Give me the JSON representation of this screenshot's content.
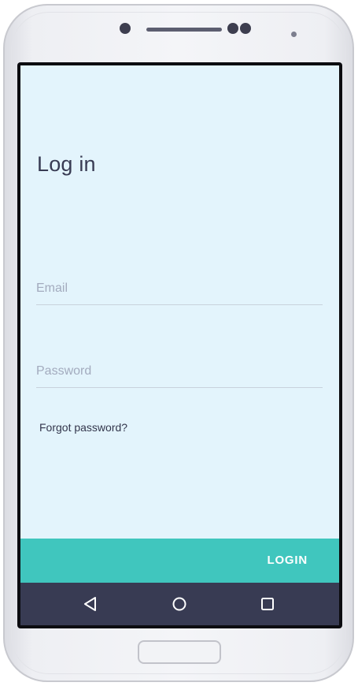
{
  "screen": {
    "title": "Log in",
    "email": {
      "placeholder": "Email",
      "value": ""
    },
    "password": {
      "placeholder": "Password",
      "value": ""
    },
    "forgot_label": "Forgot password?",
    "login_label": "LOGIN"
  },
  "nav": {
    "back_icon": "triangle-back-icon",
    "home_icon": "circle-home-icon",
    "recent_icon": "square-recent-apps-icon"
  },
  "colors": {
    "screen_bg": "#e3f4fc",
    "accent": "#40c6be",
    "nav_bg": "#383b53",
    "text": "#383b53"
  }
}
